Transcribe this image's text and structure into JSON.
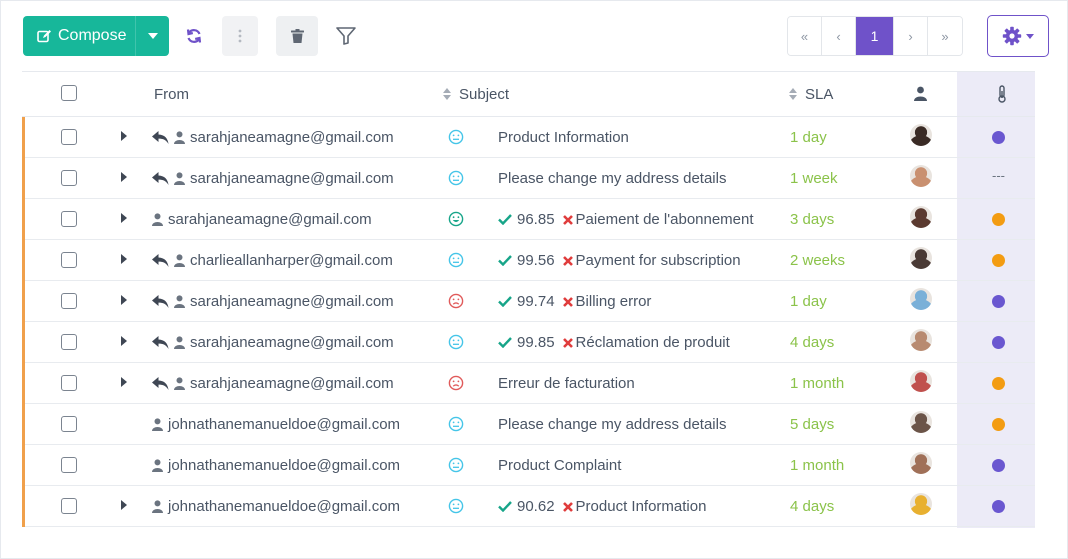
{
  "toolbar": {
    "compose_label": "Compose",
    "pagination": {
      "first": "«",
      "prev": "‹",
      "current": "1",
      "next": "›",
      "last": "»"
    }
  },
  "columns": {
    "from": "From",
    "subject": "Subject",
    "sla": "SLA"
  },
  "colors": {
    "accent": "#17b79a",
    "brand": "#6f52c9",
    "sla": "#8bc34a",
    "priority_purple": "#6a57d0",
    "priority_orange": "#f39c12",
    "row_marker": "#f0a04b"
  },
  "rows": [
    {
      "from": "sarahjaneamagne@gmail.com",
      "replied": true,
      "expand": true,
      "mood": "neutral",
      "score": "",
      "subject": "Product Information",
      "sla": "1 day",
      "avatar": "#3a2b25",
      "priority": "purple"
    },
    {
      "from": "sarahjaneamagne@gmail.com",
      "replied": true,
      "expand": true,
      "mood": "neutral",
      "score": "",
      "subject": "Please change my address details",
      "sla": "1 week",
      "avatar": "#c99070",
      "priority": "none",
      "priority_text": "---"
    },
    {
      "from": "sarahjaneamagne@gmail.com",
      "replied": false,
      "expand": true,
      "mood": "happy",
      "score": "96.85",
      "subject": "Paiement de l'abonnement",
      "sla": "3 days",
      "avatar": "#5b3a30",
      "priority": "orange"
    },
    {
      "from": "charlieallanharper@gmail.com",
      "replied": true,
      "expand": true,
      "mood": "neutral",
      "score": "99.56",
      "subject": "Payment for subscription",
      "sla": "2 weeks",
      "avatar": "#4a3a35",
      "priority": "orange"
    },
    {
      "from": "sarahjaneamagne@gmail.com",
      "replied": true,
      "expand": true,
      "mood": "sad",
      "score": "99.74",
      "subject": "Billing error",
      "sla": "1 day",
      "avatar": "#7ab0d8",
      "priority": "purple"
    },
    {
      "from": "sarahjaneamagne@gmail.com",
      "replied": true,
      "expand": true,
      "mood": "neutral",
      "score": "99.85",
      "subject": "Réclamation de produit",
      "sla": "4 days",
      "avatar": "#b88a70",
      "priority": "purple"
    },
    {
      "from": "sarahjaneamagne@gmail.com",
      "replied": true,
      "expand": true,
      "mood": "sad",
      "score": "",
      "subject": "Erreur de facturation",
      "sla": "1 month",
      "avatar": "#c0504d",
      "priority": "orange"
    },
    {
      "from": "johnathanemanueldoe@gmail.com",
      "replied": false,
      "expand": false,
      "mood": "neutral",
      "score": "",
      "subject": "Please change my address details",
      "sla": "5 days",
      "avatar": "#6b5448",
      "priority": "orange"
    },
    {
      "from": "johnathanemanueldoe@gmail.com",
      "replied": false,
      "expand": false,
      "mood": "neutral",
      "score": "",
      "subject": "Product Complaint",
      "sla": "1 month",
      "avatar": "#a07058",
      "priority": "purple"
    },
    {
      "from": "johnathanemanueldoe@gmail.com",
      "replied": false,
      "expand": true,
      "mood": "neutral",
      "score": "90.62",
      "subject": "Product Information",
      "sla": "4 days",
      "avatar": "#e8b030",
      "priority": "purple"
    }
  ]
}
